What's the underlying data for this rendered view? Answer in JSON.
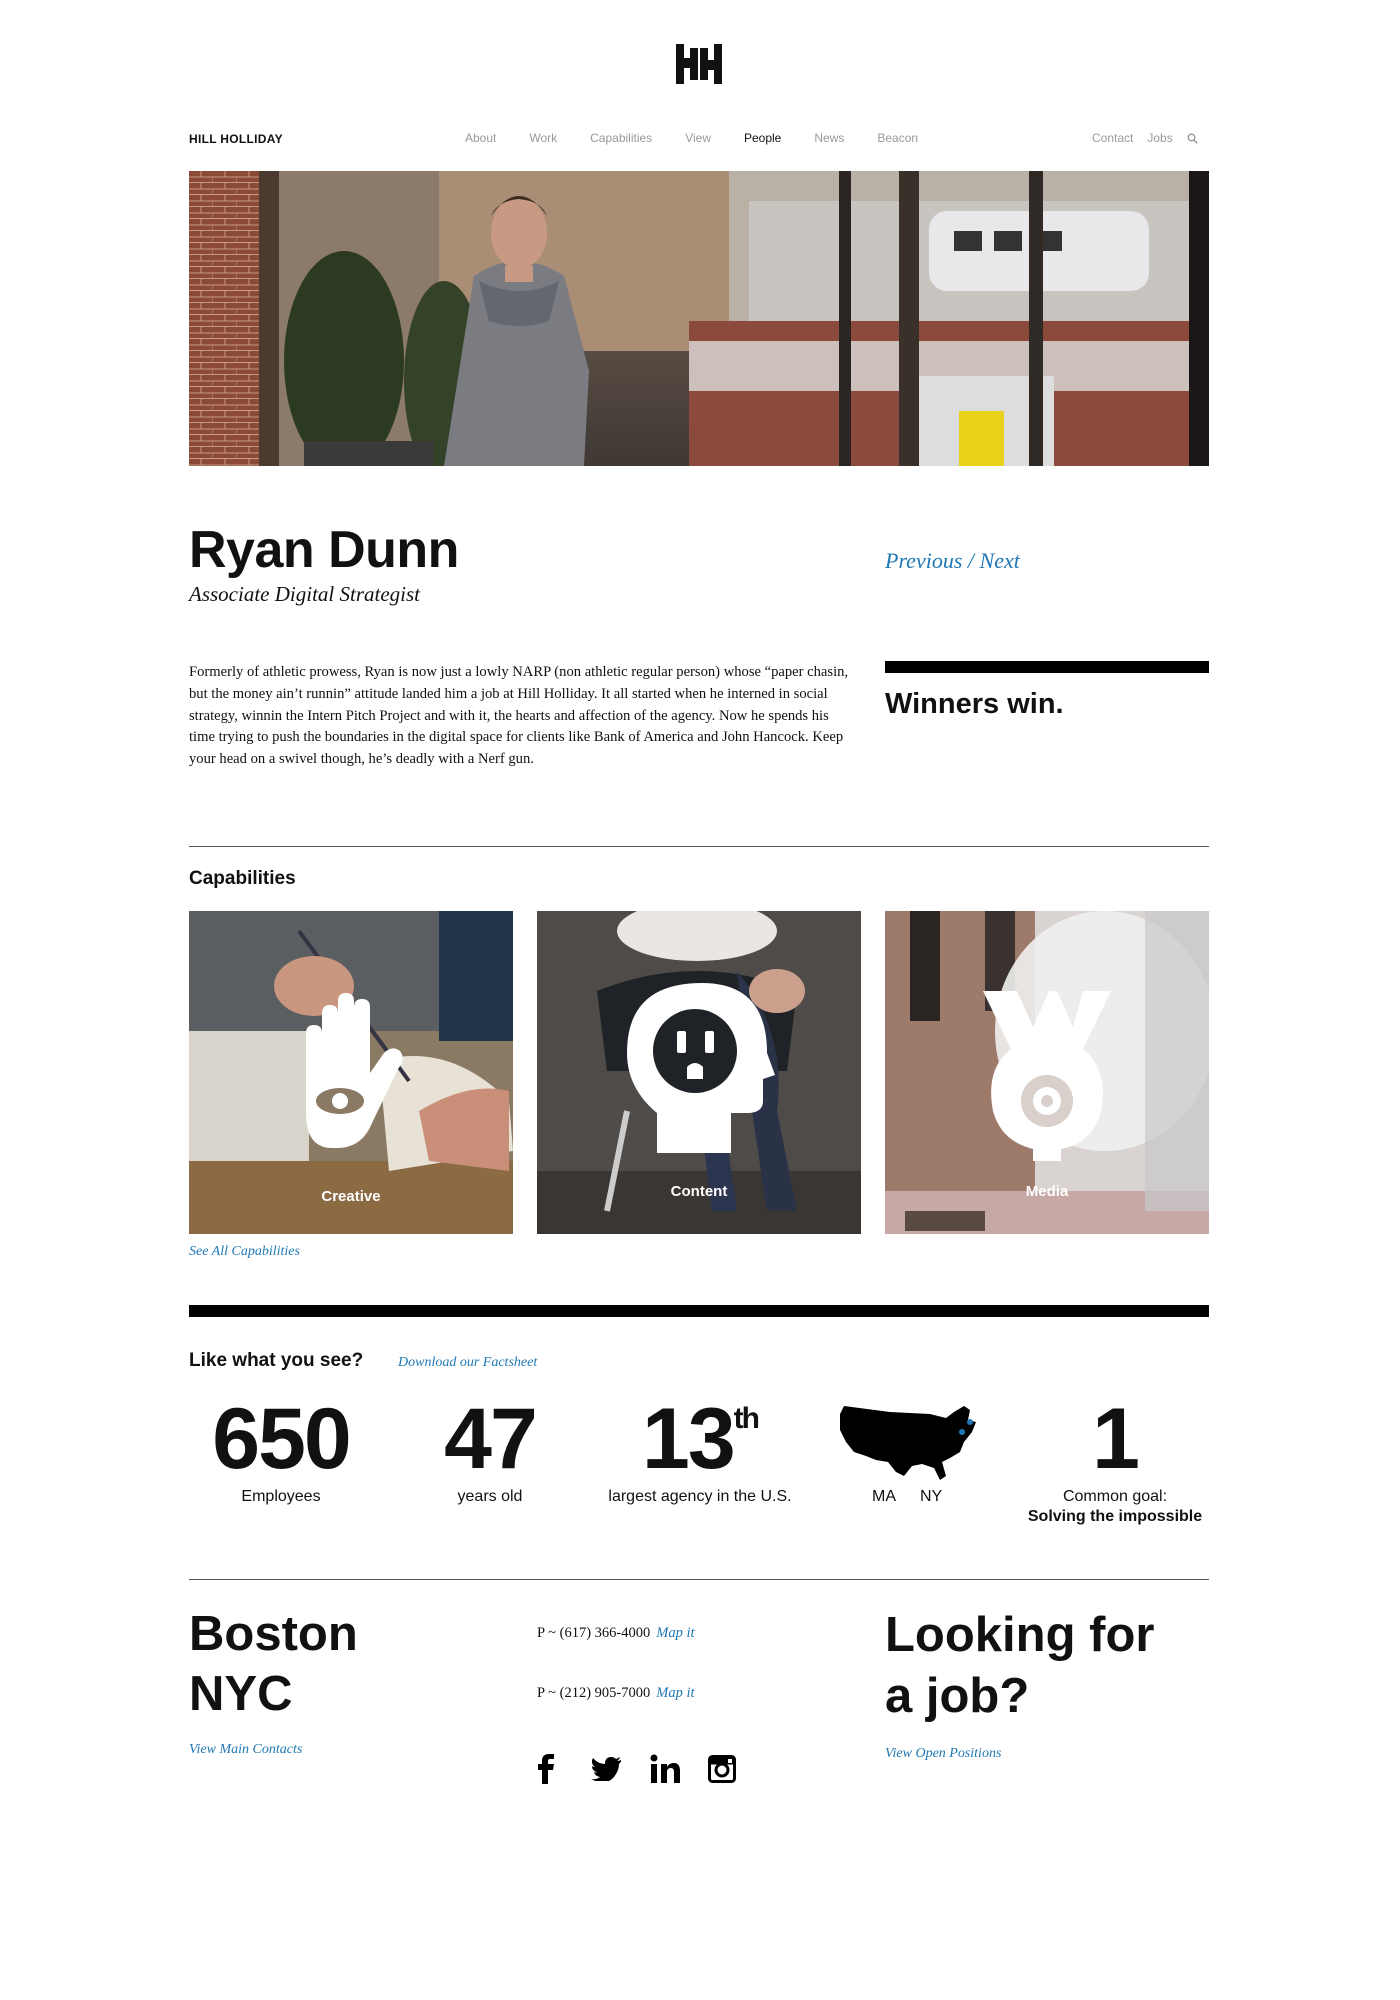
{
  "header": {
    "brand": "HILL HOLLIDAY",
    "nav": [
      "About",
      "Work",
      "Capabilities",
      "View",
      "People",
      "News",
      "Beacon"
    ],
    "active_nav": "People",
    "nav_right": [
      "Contact",
      "Jobs"
    ]
  },
  "profile": {
    "name": "Ryan Dunn",
    "title": "Associate Digital Strategist",
    "previous": "Previous",
    "separator": " / ",
    "next": "Next",
    "bio": "Formerly of athletic prowess, Ryan is now just a lowly NARP (non athletic regular person) whose “paper chasin, but the money ain’t runnin” attitude landed him a job at Hill Holliday. It all started when he interned in social strategy, winnin the Intern Pitch Project and with it, the hearts and affection of the agency. Now he spends his time trying to push the boundaries in the digital space for clients like Bank of America and John Hancock. Keep your head on a swivel though, he’s deadly with a Nerf gun.",
    "quote": "Winners win."
  },
  "capabilities": {
    "heading": "Capabilities",
    "tiles": [
      "Creative",
      "Content",
      "Media"
    ],
    "see_all": "See All Capabilities"
  },
  "stats": {
    "like_heading": "Like what you see?",
    "factsheet": "Download our Factsheet",
    "employees_num": "650",
    "employees_lbl": "Employees",
    "years_num": "47",
    "years_lbl": "years old",
    "rank_num": "13",
    "rank_sup": "th",
    "rank_lbl": "largest agency in the U.S.",
    "map_ma": "MA",
    "map_ny": "NY",
    "goal_num": "1",
    "goal_lbl": "Common goal:",
    "goal_bold": "Solving the impossible"
  },
  "footer": {
    "city1": "Boston",
    "city2": "NYC",
    "main_contacts": "View Main Contacts",
    "phone1": "P ~ (617) 366-4000",
    "phone2": "P ~ (212) 905-7000",
    "map_it": "Map it",
    "job1": "Looking for",
    "job2": "a job?",
    "open_positions": "View Open Positions",
    "social": [
      "facebook-icon",
      "twitter-icon",
      "linkedin-icon",
      "instagram-icon"
    ]
  },
  "colors": {
    "accent": "#1f78b4",
    "text": "#111111",
    "nav_muted": "#9a9a9a"
  }
}
